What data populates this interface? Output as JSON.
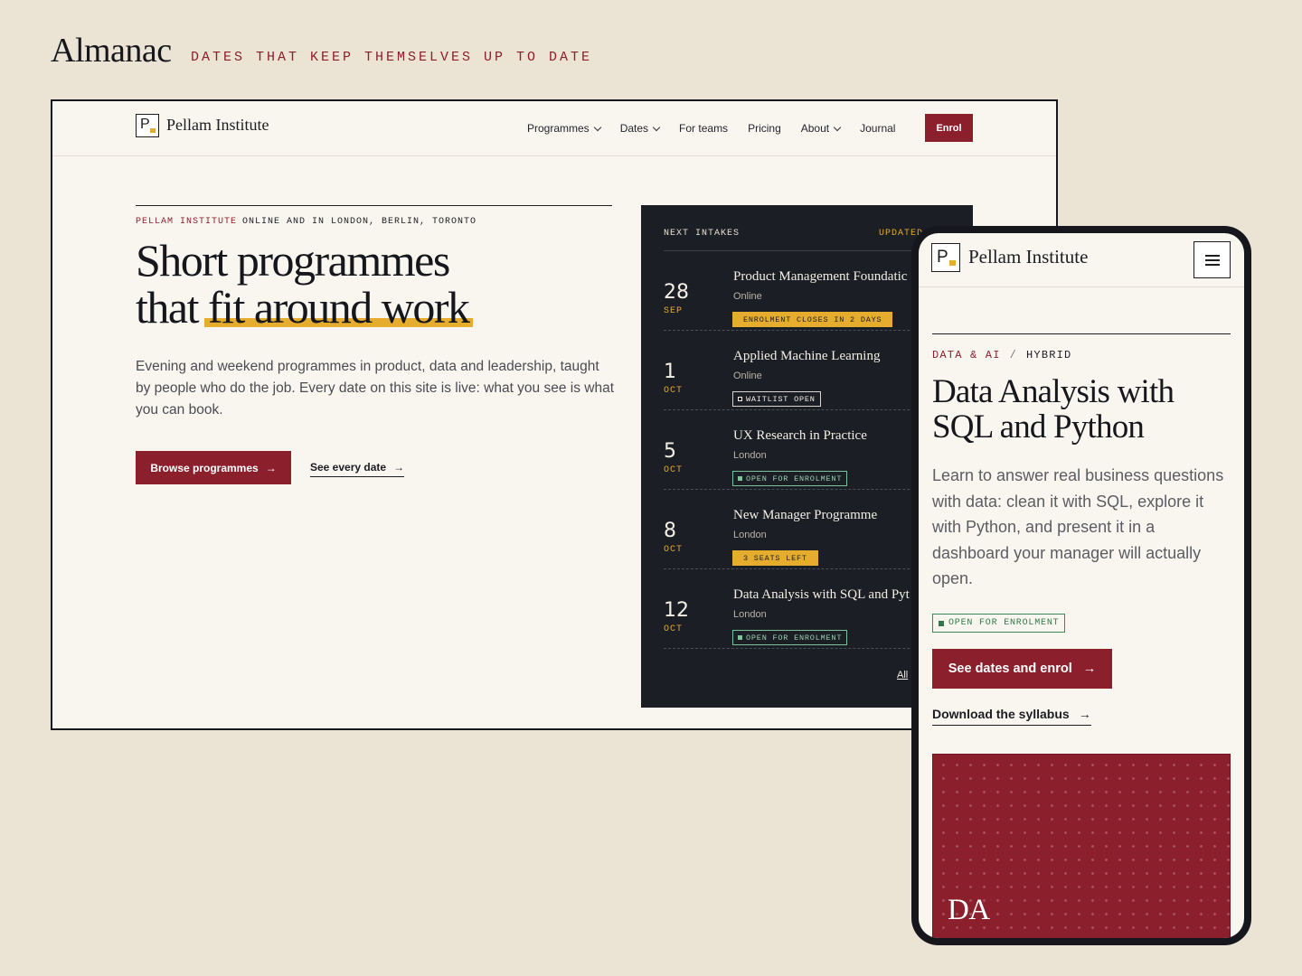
{
  "header": {
    "brand": "Almanac",
    "tagline": "DATES THAT KEEP THEMSELVES UP TO DATE"
  },
  "colors": {
    "accent_red": "#8c1f2c",
    "highlight_yellow": "#e5ac2e",
    "panel_dark": "#1b1e24",
    "page_bg": "#ebe3d4",
    "surface": "#f9f6f0",
    "status_green": "#7cc39a"
  },
  "desktop": {
    "logo_letter": "P",
    "logo_text": "Pellam Institute",
    "nav": [
      {
        "label": "Programmes",
        "has_dropdown": true
      },
      {
        "label": "Dates",
        "has_dropdown": true
      },
      {
        "label": "For teams",
        "has_dropdown": false
      },
      {
        "label": "Pricing",
        "has_dropdown": false
      },
      {
        "label": "About",
        "has_dropdown": true
      },
      {
        "label": "Journal",
        "has_dropdown": false
      }
    ],
    "enrol_label": "Enrol",
    "eyebrow_brand": "PELLAM INSTITUTE",
    "eyebrow_locations": "ONLINE AND IN LONDON, BERLIN, TORONTO",
    "title_line1": "Short programmes",
    "title_line2_prefix": "that ",
    "title_line2_highlight": "fit around work",
    "description": "Evening and weekend programmes in product, data and leadership, taught by people who do the job. Every date on this site is live: what you see is what you can book.",
    "browse_label": "Browse programmes",
    "see_dates_label": "See every date",
    "arrow": "→",
    "intakes": {
      "heading": "NEXT INTAKES",
      "updated": "UPDATED",
      "items": [
        {
          "day": "28",
          "month": "SEP",
          "title": "Product Management Foundatic",
          "location": "Online",
          "badge": "ENROLMENT CLOSES IN 2 DAYS",
          "badge_style": "yellow"
        },
        {
          "day": "1",
          "month": "OCT",
          "title": "Applied Machine Learning",
          "location": "Online",
          "badge": "WAITLIST OPEN",
          "badge_style": "outline-white"
        },
        {
          "day": "5",
          "month": "OCT",
          "title": "UX Research in Practice",
          "location": "London",
          "badge": "OPEN FOR ENROLMENT",
          "badge_style": "outline-green"
        },
        {
          "day": "8",
          "month": "OCT",
          "title": "New Manager Programme",
          "location": "London",
          "badge": "3 SEATS LEFT",
          "badge_style": "yellow"
        },
        {
          "day": "12",
          "month": "OCT",
          "title": "Data Analysis with SQL and Pyt",
          "location": "London",
          "badge": "OPEN FOR ENROLMENT",
          "badge_style": "outline-green"
        }
      ],
      "all_label": "All"
    }
  },
  "mobile": {
    "logo_letter": "P",
    "logo_text": "Pellam Institute",
    "eyebrow_category": "DATA & AI",
    "eyebrow_sep": "/",
    "eyebrow_format": "HYBRID",
    "title": "Data Analysis with SQL and Python",
    "description": "Learn to answer real business questions with data: clean it with SQL, explore it with Python, and present it in a dashboard your manager will actually open.",
    "status_badge": "OPEN FOR ENROLMENT",
    "cta_label": "See dates and enrol",
    "syllabus_label": "Download the syllabus",
    "arrow": "→",
    "card_initials": "DA"
  }
}
